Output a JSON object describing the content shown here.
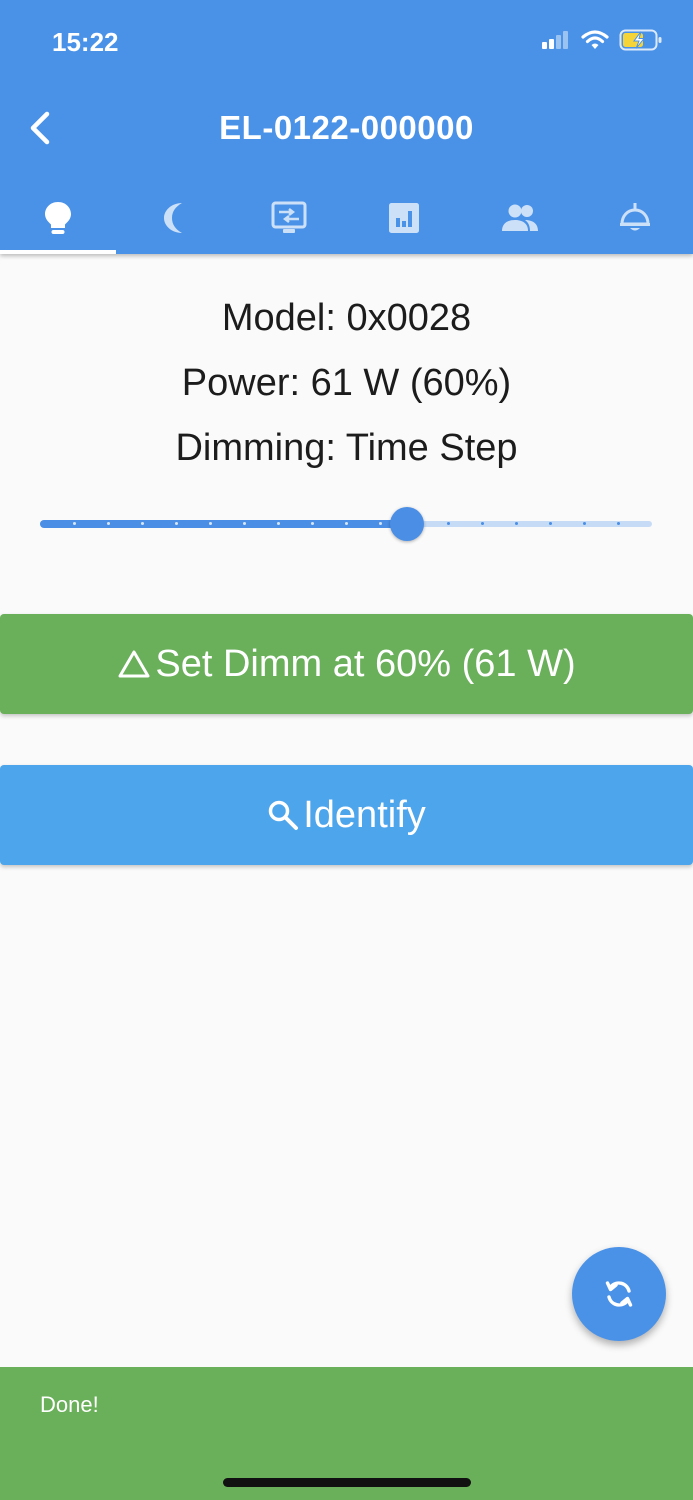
{
  "status_bar": {
    "time": "15:22"
  },
  "header": {
    "title": "EL-0122-000000",
    "tabs": [
      {
        "icon": "lightbulb-icon",
        "active": true
      },
      {
        "icon": "moon-icon",
        "active": false
      },
      {
        "icon": "settings-display-icon",
        "active": false
      },
      {
        "icon": "bar-chart-icon",
        "active": false
      },
      {
        "icon": "group-icon",
        "active": false
      },
      {
        "icon": "ceiling-lamp-icon",
        "active": false
      }
    ]
  },
  "info": {
    "model": "Model: 0x0028",
    "power": "Power: 61 W (60%)",
    "dimming": "Dimming: Time Step"
  },
  "slider": {
    "value_percent": 60,
    "min": 0,
    "max": 100,
    "divisions": 18
  },
  "buttons": {
    "set_dimm": "Set Dimm at 60% (61 W)",
    "identify": "Identify"
  },
  "snackbar": {
    "message": "Done!"
  },
  "colors": {
    "primary": "#4a92e8",
    "success": "#6aaf5a",
    "identify": "#4da5ec"
  }
}
